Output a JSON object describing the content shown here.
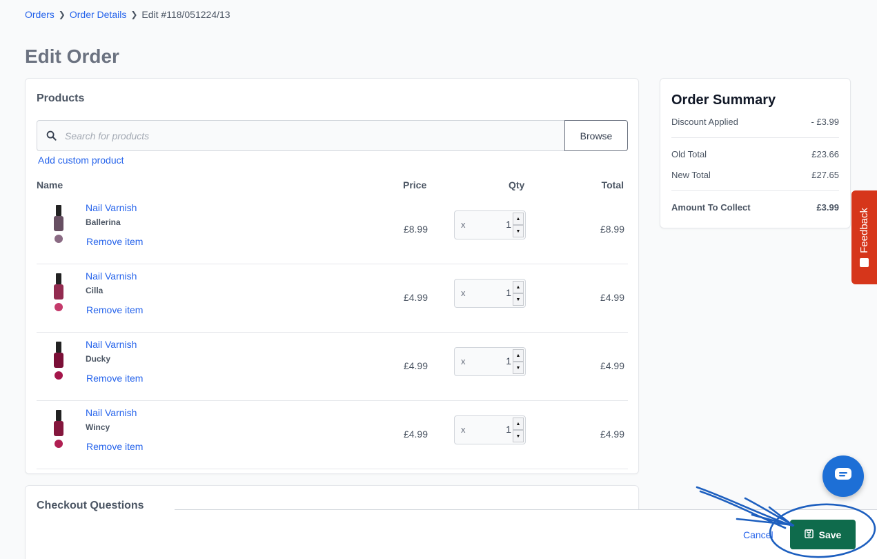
{
  "breadcrumb": {
    "orders": "Orders",
    "order_details": "Order Details",
    "current": "Edit #118/051224/13"
  },
  "page": {
    "title": "Edit Order"
  },
  "products": {
    "heading": "Products",
    "search_placeholder": "Search for products",
    "browse_label": "Browse",
    "add_custom_label": "Add custom product",
    "columns": {
      "name": "Name",
      "price": "Price",
      "qty": "Qty",
      "total": "Total"
    },
    "remove_label": "Remove item",
    "qty_prefix": "x",
    "items": [
      {
        "name": "Nail Varnish",
        "variant": "Ballerina",
        "price": "£8.99",
        "qty": "1",
        "total": "£8.99",
        "color": "#8a6a83"
      },
      {
        "name": "Nail Varnish",
        "variant": "Cilla",
        "price": "£4.99",
        "qty": "1",
        "total": "£4.99",
        "color": "#c43a6b"
      },
      {
        "name": "Nail Varnish",
        "variant": "Ducky",
        "price": "£4.99",
        "qty": "1",
        "total": "£4.99",
        "color": "#a4154a"
      },
      {
        "name": "Nail Varnish",
        "variant": "Wincy",
        "price": "£4.99",
        "qty": "1",
        "total": "£4.99",
        "color": "#b01f52"
      }
    ]
  },
  "checkout": {
    "heading": "Checkout Questions"
  },
  "summary": {
    "title": "Order Summary",
    "discount_label": "Discount Applied",
    "discount_value": "- £3.99",
    "old_total_label": "Old Total",
    "old_total_value": "£23.66",
    "new_total_label": "New Total",
    "new_total_value": "£27.65",
    "collect_label": "Amount To Collect",
    "collect_value": "£3.99"
  },
  "feedback": {
    "label": "Feedback"
  },
  "footer": {
    "cancel_label": "Cancel",
    "save_label": "Save"
  },
  "colors": {
    "link": "#2563eb",
    "save_bg": "#0f6b4c",
    "feedback_bg": "#d6361b",
    "chat_bg": "#1d6fd6",
    "annotation": "#1d5fbf"
  },
  "icons": {
    "search": "search-icon",
    "save": "floppy-disk-icon",
    "chat": "chat-icon",
    "feedback": "feedback-icon"
  }
}
